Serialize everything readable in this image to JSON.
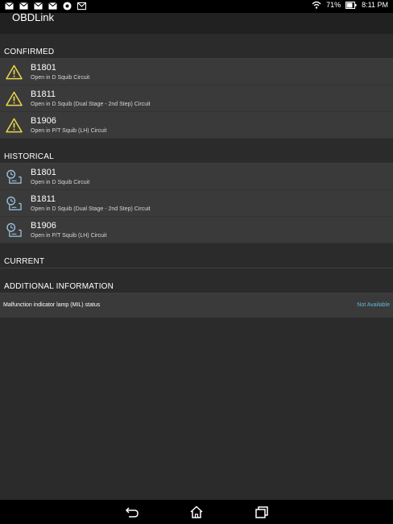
{
  "status": {
    "battery": "71%",
    "time": "8:11 PM"
  },
  "app": {
    "title": "OBDLink"
  },
  "sections": {
    "confirmed": {
      "header": "CONFIRMED",
      "items": [
        {
          "code": "B1801",
          "desc": "Open in D Squib Circuit"
        },
        {
          "code": "B1811",
          "desc": "Open in D Squib (Dual Stage - 2nd Step) Circuit"
        },
        {
          "code": "B1906",
          "desc": "Open in P/T Squib (LH) Circuit"
        }
      ]
    },
    "historical": {
      "header": "HISTORICAL",
      "items": [
        {
          "code": "B1801",
          "desc": "Open in D Squib Circuit"
        },
        {
          "code": "B1811",
          "desc": "Open in D Squib (Dual Stage - 2nd Step) Circuit"
        },
        {
          "code": "B1906",
          "desc": "Open in P/T Squib (LH) Circuit"
        }
      ]
    },
    "current": {
      "header": "CURRENT"
    },
    "additional": {
      "header": "ADDITIONAL INFORMATION",
      "mil_label": "Malfunction indicator lamp (MIL) status",
      "mil_value": "Not Available"
    }
  },
  "icons": {
    "confirmed": "warning-icon",
    "historical": "history-icon"
  },
  "colors": {
    "warning": "#e8d84a",
    "link": "#64b5d9",
    "history_icon": "#9fc6e3"
  }
}
